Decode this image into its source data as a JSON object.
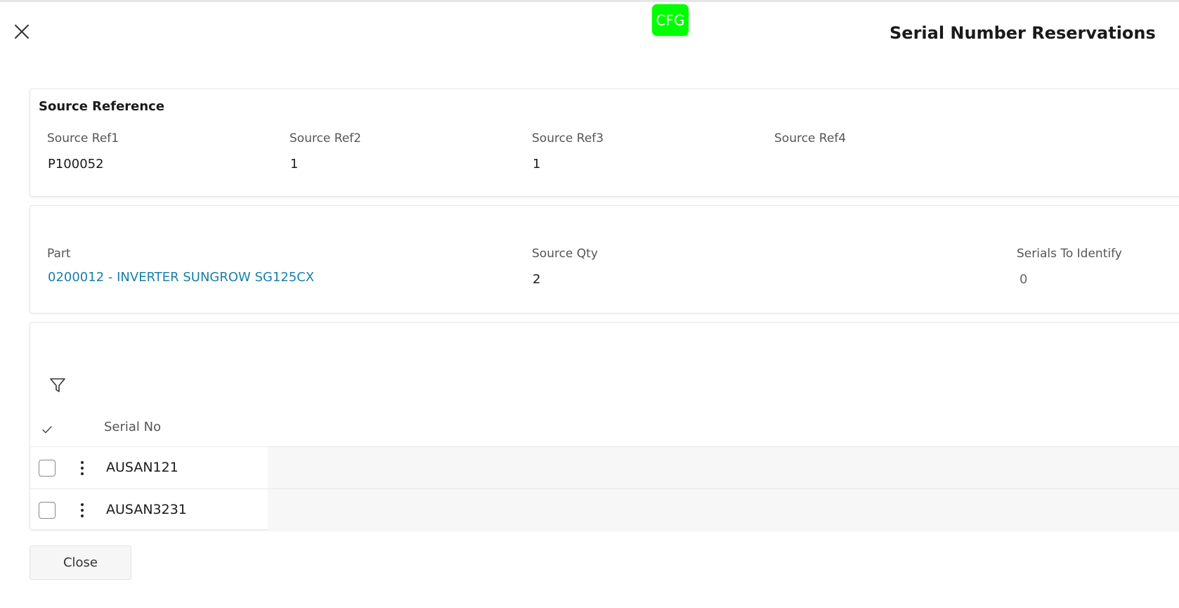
{
  "env_badge": "CFG",
  "dialog": {
    "title": "Serial Number Reservations"
  },
  "source_reference": {
    "title": "Source Reference",
    "fields": [
      {
        "label": "Source Ref1",
        "value": "P100052"
      },
      {
        "label": "Source Ref2",
        "value": "1"
      },
      {
        "label": "Source Ref3",
        "value": "1"
      },
      {
        "label": "Source Ref4",
        "value": ""
      }
    ]
  },
  "part_info": {
    "part": {
      "label": "Part",
      "value": "0200012 - INVERTER SUNGROW SG125CX"
    },
    "source_qty": {
      "label": "Source Qty",
      "value": "2"
    },
    "serials_to_identify": {
      "label": "Serials To Identify",
      "value": "0"
    }
  },
  "serial_list": {
    "column_header": "Serial No",
    "rows": [
      {
        "serial_no": "AUSAN121"
      },
      {
        "serial_no": "AUSAN3231"
      }
    ]
  },
  "footer": {
    "close_label": "Close"
  },
  "icons": {
    "close": "close-icon",
    "filter": "filter-icon",
    "select_all": "checkmark-icon",
    "row_menu": "kebab-menu-icon"
  },
  "colors": {
    "env_badge": "#00ff00",
    "link": "#1a7fa8"
  }
}
